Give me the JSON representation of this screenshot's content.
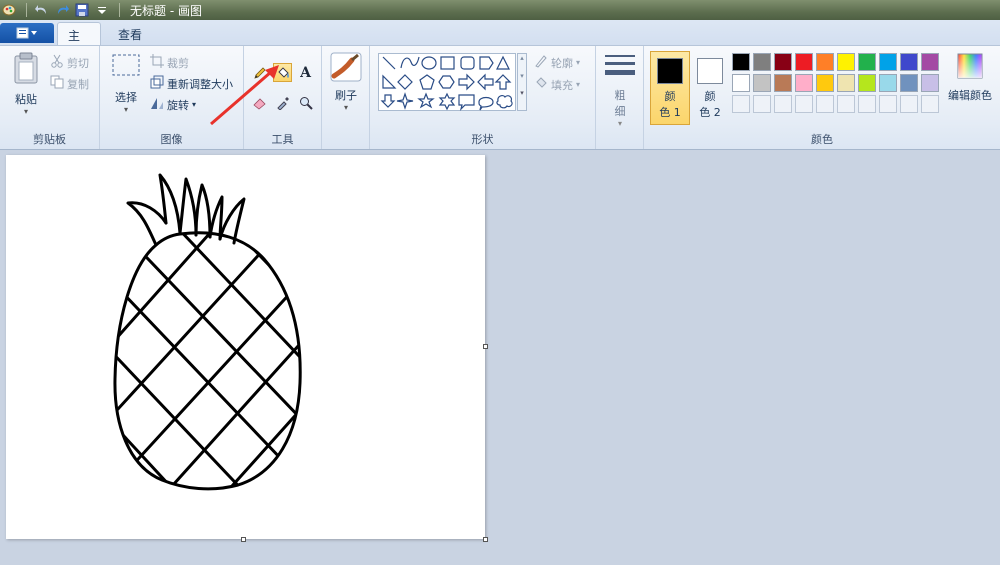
{
  "titlebar": {
    "title": "无标题 - 画图",
    "icons": [
      "paint-app-icon",
      "undo-icon",
      "redo-icon",
      "save-icon",
      "customize-dropdown-icon"
    ]
  },
  "tabs": {
    "file_menu_icon": "document-menu-icon",
    "home": "主页",
    "view": "查看"
  },
  "clipboard": {
    "paste": "粘贴",
    "cut": "剪切",
    "copy": "复制",
    "label": "剪贴板"
  },
  "image": {
    "select": "选择",
    "crop": "裁剪",
    "resize": "重新调整大小",
    "rotate": "旋转",
    "label": "图像"
  },
  "tools": {
    "label": "工具",
    "selected_tool": "fill-bucket",
    "items": [
      "pencil-icon",
      "fill-bucket-icon",
      "text-icon",
      "eraser-icon",
      "color-picker-icon",
      "magnifier-icon"
    ]
  },
  "brushes": {
    "label": "刷子"
  },
  "shapes": {
    "label": "形状",
    "outline": "轮廓",
    "fill": "填充"
  },
  "size": {
    "line1": "粗",
    "line2": "细"
  },
  "colors": {
    "label": "颜色",
    "color1_line1": "颜",
    "color1_line2": "色 1",
    "color1_value": "#000000",
    "color2_line1": "颜",
    "color2_line2": "色 2",
    "color2_value": "#ffffff",
    "edit_colors": "编辑颜色",
    "palette_row1": [
      "#000000",
      "#7f7f7f",
      "#880015",
      "#ed1c24",
      "#ff7f27",
      "#fff200",
      "#22b14c",
      "#00a2e8",
      "#3f48cc",
      "#a349a4"
    ],
    "palette_row2": [
      "#ffffff",
      "#c3c3c3",
      "#b97a57",
      "#ffaec9",
      "#ffc90e",
      "#efe4b0",
      "#b5e61d",
      "#99d9ea",
      "#7092be",
      "#c8bfe7"
    ],
    "palette_row3": [
      "",
      "",
      "",
      "",
      "",
      "",
      "",
      "",
      "",
      ""
    ]
  },
  "annotation": {
    "arrow_color": "#e8322b"
  }
}
